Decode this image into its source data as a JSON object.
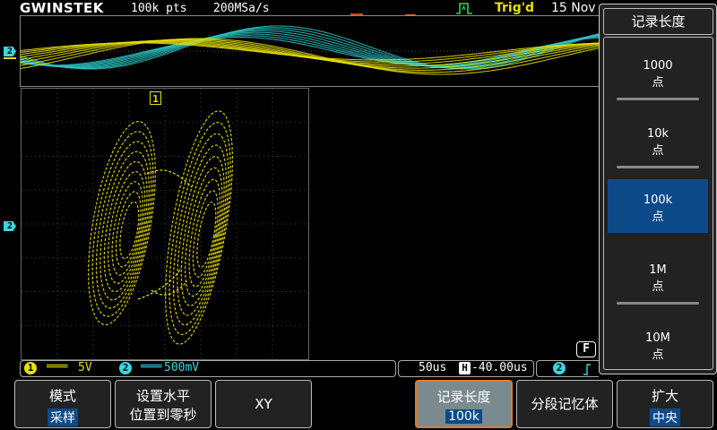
{
  "header": {
    "logo": "GWINSTEK",
    "record_points": "100k pts",
    "sample_rate": "200MSa/s",
    "trigger_status": "Trig'd",
    "date": "15 Nov"
  },
  "channel_markers": {
    "ch2_top": "2",
    "ch2_main": "2",
    "ch1_top": "1"
  },
  "status_bar": {
    "ch1_label": "1",
    "ch1_scale": "5V",
    "ch2_label": "2",
    "ch2_scale": "500mV",
    "timebase": "50us",
    "h_label": "H",
    "h_position": "-40.00us",
    "trig_src": "2",
    "filter_badge": "F"
  },
  "softkeys": [
    {
      "label": "模式",
      "value": "采样"
    },
    {
      "label": "设置水平",
      "label2": "位置到零秒"
    },
    {
      "label": "XY"
    },
    {
      "label": "记录长度",
      "value": "100k"
    },
    {
      "label": "分段记忆体"
    },
    {
      "label": "扩大",
      "value": "中央"
    }
  ],
  "side_menu": {
    "title": "记录长度",
    "options": [
      {
        "value": "1000",
        "unit": "点",
        "selected": false
      },
      {
        "value": "10k",
        "unit": "点",
        "selected": false
      },
      {
        "value": "100k",
        "unit": "点",
        "selected": true
      },
      {
        "value": "1M",
        "unit": "点",
        "selected": false
      },
      {
        "value": "10M",
        "unit": "点",
        "selected": false
      }
    ]
  },
  "colors": {
    "ch1": "#e8e000",
    "ch2": "#2ac6c6",
    "accent_selected": "#0d4a8a",
    "trigger_marker": "#ff5a1a"
  }
}
